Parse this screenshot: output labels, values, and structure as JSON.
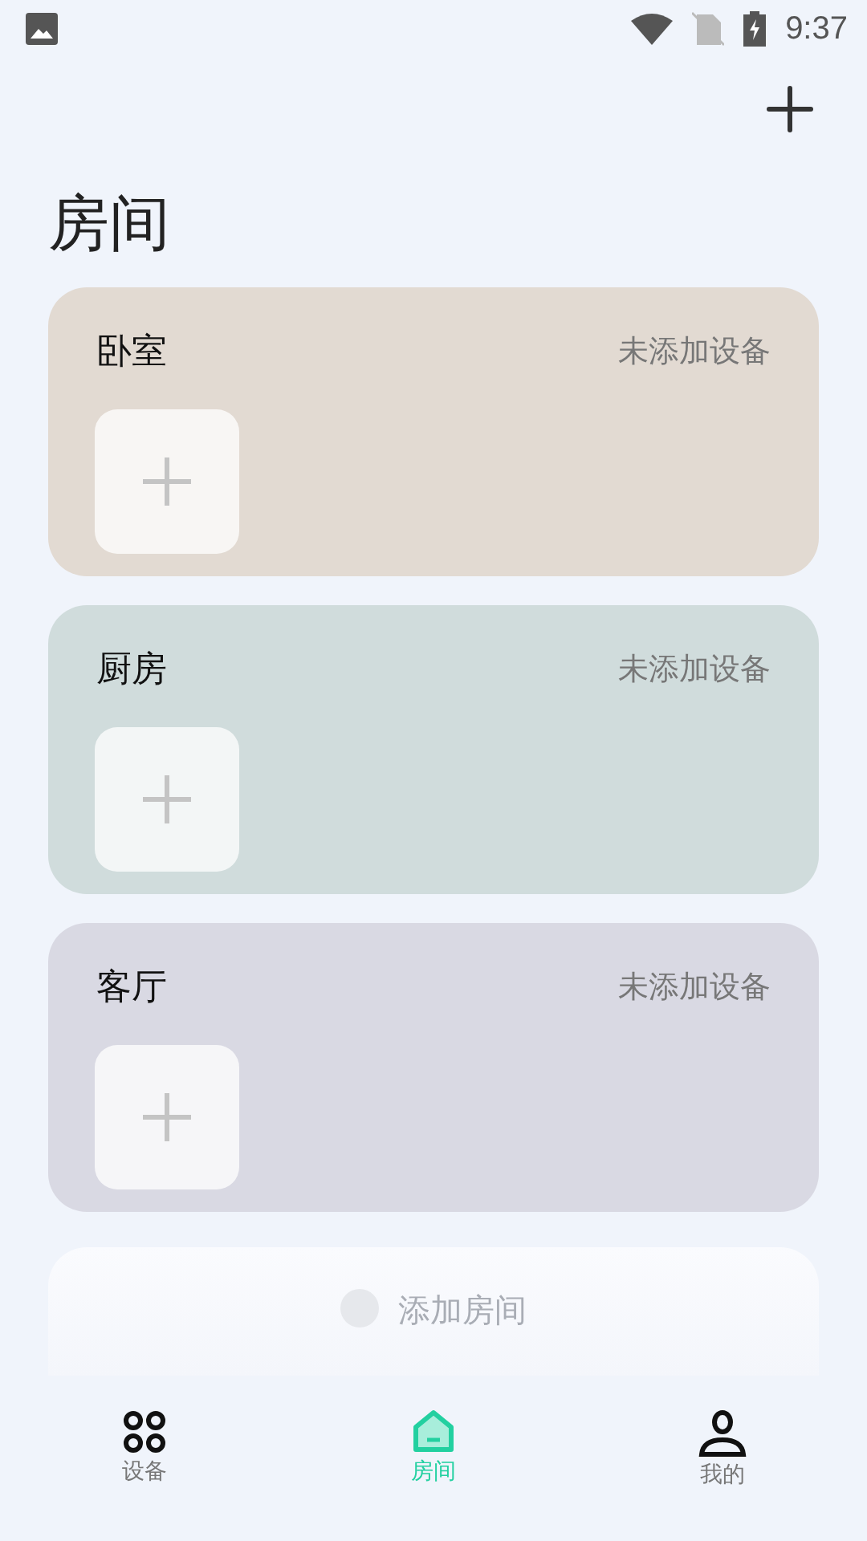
{
  "status_bar": {
    "time": "9:37"
  },
  "title": "房间",
  "rooms": [
    {
      "name": "卧室",
      "status": "未添加设备",
      "color": "#e2dad2"
    },
    {
      "name": "厨房",
      "status": "未添加设备",
      "color": "#d0dcdc"
    },
    {
      "name": "客厅",
      "status": "未添加设备",
      "color": "#d9d9e3"
    }
  ],
  "add_room": {
    "label": "添加房间"
  },
  "nav": [
    {
      "label": "设备",
      "selected": false
    },
    {
      "label": "房间",
      "selected": true
    },
    {
      "label": "我的",
      "selected": false
    }
  ]
}
